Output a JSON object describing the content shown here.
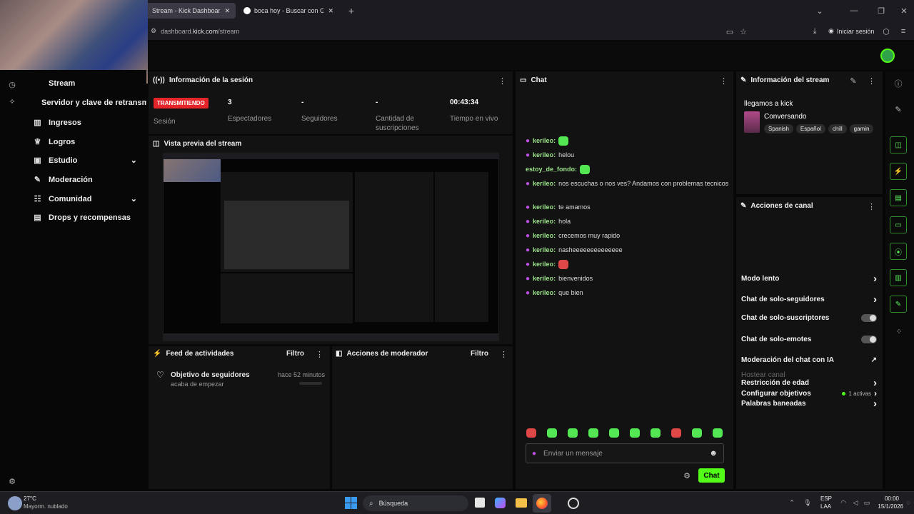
{
  "browser": {
    "tabs": [
      {
        "label": "Stream - Kick Dashboard"
      },
      {
        "label": "boca hoy - Buscar con Google"
      }
    ],
    "url_prefix": "dashboard.",
    "url_domain": "kick.com",
    "url_path": "/stream",
    "signin_label": "Iniciar sesión"
  },
  "sidebar": {
    "items": [
      {
        "label": "Stream",
        "icon": "stream-icon"
      },
      {
        "label": "Servidor y clave de retransm",
        "icon": "key-icon"
      },
      {
        "label": "Ingresos",
        "icon": "chart-icon"
      },
      {
        "label": "Logros",
        "icon": "trophy-icon"
      },
      {
        "label": "Estudio",
        "icon": "video-icon"
      },
      {
        "label": "Moderación",
        "icon": "wrench-icon"
      },
      {
        "label": "Comunidad",
        "icon": "users-icon"
      },
      {
        "label": "Drops y recompensas",
        "icon": "gift-icon"
      }
    ]
  },
  "session": {
    "title": "Información de la sesión",
    "status_badge": "TRANSMITIENDO",
    "status_label": "Sesión",
    "viewers_value": "3",
    "viewers_label": "Espectadores",
    "followers_value": "-",
    "followers_label": "Seguidores",
    "subs_value": "-",
    "subs_label": "Cantidad de suscripciones",
    "live_time_value": "00:43:34",
    "live_time_label": "Tiempo en vivo"
  },
  "preview": {
    "title": "Vista previa del stream"
  },
  "activity": {
    "title": "Feed de actividades",
    "filter": "Filtro",
    "item_title": "Objetivo de seguidores",
    "item_sub": "acaba de empezar",
    "item_time": "hace 52 minutos"
  },
  "mod_actions": {
    "title": "Acciones de moderador",
    "filter": "Filtro"
  },
  "chat": {
    "title": "Chat",
    "messages": [
      {
        "user": "kerileo:",
        "text": "",
        "emote": "green"
      },
      {
        "user": "kerileo:",
        "text": "helou",
        "emote": ""
      },
      {
        "user": "estoy_de_fondo:",
        "text": "",
        "emote": "green"
      },
      {
        "user": "kerileo:",
        "text": "nos escuchas o nos ves? Andamos con problemas tecnicos",
        "emote": ""
      },
      {
        "user": "kerileo:",
        "text": "te amamos",
        "emote": ""
      },
      {
        "user": "kerileo:",
        "text": "hola",
        "emote": ""
      },
      {
        "user": "kerileo:",
        "text": "crecemos muy rapido",
        "emote": ""
      },
      {
        "user": "kerileo:",
        "text": "nasheeeeeeeeeeeeee",
        "emote": ""
      },
      {
        "user": "kerileo:",
        "text": "",
        "emote": "red"
      },
      {
        "user": "kerileo:",
        "text": "bienvenidos",
        "emote": ""
      },
      {
        "user": "kerileo:",
        "text": "que bien",
        "emote": ""
      }
    ],
    "input_placeholder": "Enviar un mensaje",
    "send_label": "Chat"
  },
  "stream_info": {
    "title": "Información del stream",
    "stream_title": "llegamos a kick",
    "category": "Conversando",
    "tags": [
      "Spanish",
      "Español",
      "chill",
      "gamin"
    ]
  },
  "channel_actions": {
    "title": "Acciones de canal",
    "items": [
      {
        "label": "Modo lento",
        "control": "chevron"
      },
      {
        "label": "Chat de solo-seguidores",
        "control": "chevron"
      },
      {
        "label": "Chat de solo-suscriptores",
        "control": "toggle"
      },
      {
        "label": "Chat de solo-emotes",
        "control": "toggle"
      },
      {
        "label": "Moderación del chat con IA",
        "control": "external"
      },
      {
        "label": "Restricción de edad",
        "control": "chevron"
      },
      {
        "label": "Palabras baneadas",
        "control": "chevron"
      }
    ],
    "host_label": "Hostear canal",
    "goals_label": "Configurar objetivos",
    "goals_status": "1 activas"
  },
  "taskbar": {
    "weather_temp": "27°C",
    "weather_desc": "Mayorm. nublado",
    "search_label": "Búsqueda",
    "lang_top": "ESP",
    "lang_bottom": "LAA",
    "clock_time": "00:00",
    "clock_date": "15/1/2026"
  },
  "colors": {
    "accent": "#53fc18",
    "live": "#e5252a",
    "panel": "#121212",
    "username": "#9be38a"
  }
}
